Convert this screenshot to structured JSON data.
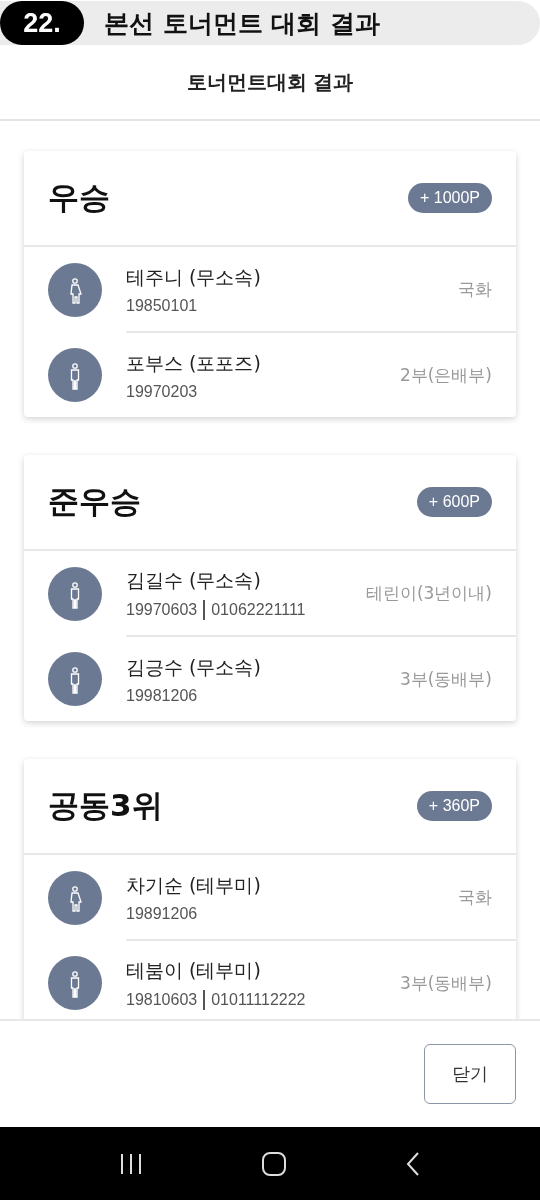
{
  "banner": {
    "number": "22.",
    "title": "본선 토너먼트 대회 결과"
  },
  "header": {
    "title": "토너먼트대회 결과"
  },
  "results": [
    {
      "rank": "우승",
      "points": "+ 1000P",
      "players": [
        {
          "kind": "female",
          "name": "테주니 (무소속)",
          "birth": "19850101",
          "category": "국화"
        },
        {
          "kind": "male",
          "name": "포부스 (포포즈)",
          "birth": "19970203",
          "category": "2부(은배부)"
        }
      ]
    },
    {
      "rank": "준우승",
      "points": "+ 600P",
      "players": [
        {
          "kind": "male",
          "name": "김길수 (무소속)",
          "birth": "19970603",
          "phone": "01062221111",
          "category": "테린이(3년이내)"
        },
        {
          "kind": "male",
          "name": "김긍수 (무소속)",
          "birth": "19981206",
          "category": "3부(동배부)"
        }
      ]
    },
    {
      "rank": "공동3위",
      "points": "+ 360P",
      "players": [
        {
          "kind": "female",
          "name": "차기순 (테부미)",
          "birth": "19891206",
          "category": "국화"
        },
        {
          "kind": "male",
          "name": "테붐이 (테부미)",
          "birth": "19810603",
          "phone": "01011112222",
          "category": "3부(동배부)"
        }
      ]
    }
  ],
  "footer": {
    "close_button": "닫기"
  }
}
